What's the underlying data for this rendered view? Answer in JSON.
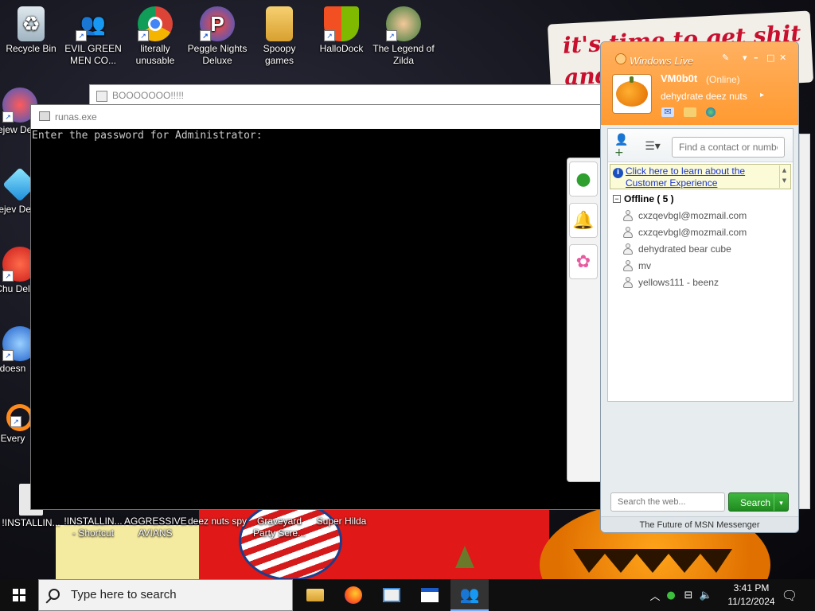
{
  "desktop": {
    "wallpaper_text": "it's time to get shit and",
    "icons": [
      {
        "label": "Recycle Bin",
        "icon": "recycle-bin-icon"
      },
      {
        "label": "EVIL GREEN MEN CO...",
        "icon": "green-men-icon"
      },
      {
        "label": "literally unusable",
        "icon": "chrome-icon"
      },
      {
        "label": "Peggle Nights Deluxe",
        "icon": "peggle-icon"
      },
      {
        "label": "Spoopy games",
        "icon": "folder-icon"
      },
      {
        "label": "HalloDock",
        "icon": "hallodock-icon"
      },
      {
        "label": "The Legend of Zilda",
        "icon": "zilda-icon"
      },
      {
        "label": "Bejew Del",
        "icon": "bejeweled-icon"
      },
      {
        "label": "Bejev Del",
        "icon": "bejeweled-gem-icon"
      },
      {
        "label": "Chu Del",
        "icon": "chuzzle-icon"
      },
      {
        "label": "doesn",
        "icon": "blue-app-icon"
      },
      {
        "label": "Every",
        "icon": "orange-app-icon"
      },
      {
        "label": "!INSTALLIN...",
        "icon": "installer-icon"
      },
      {
        "label": "!INSTALLIN... - Shortcut",
        "icon": "installer-shortcut-icon"
      },
      {
        "label": "AGGRESSIVE AVIANS",
        "icon": "avians-icon"
      },
      {
        "label": "deez nuts spy",
        "icon": "spy-icon"
      },
      {
        "label": "Graveyard Party Scre...",
        "icon": "graveyard-icon"
      },
      {
        "label": "Super Hilda",
        "icon": "hilda-icon"
      }
    ]
  },
  "bg_window": {
    "title": "BOOOOOOO!!!!!"
  },
  "console": {
    "title": "runas.exe",
    "output": "Enter the password for Administrator:"
  },
  "msn": {
    "brand": "Windows Live",
    "username": "VM0b0t",
    "status": "(Online)",
    "personal_message": "dehydrate deez nuts",
    "search_contact_placeholder": "Find a contact or number",
    "info_link": "Click here to learn about the Customer Experience",
    "group": {
      "label": "Offline ( 5 )"
    },
    "contacts": [
      {
        "name": "cxzqevbgl@mozmail.com"
      },
      {
        "name": "cxzqevbgl@mozmail.com"
      },
      {
        "name": "dehydrated bear cube"
      },
      {
        "name": "mv"
      },
      {
        "name": "yellows111 - beenz"
      }
    ],
    "web_search_placeholder": "Search the web...",
    "search_button": "Search",
    "footer": "The Future of MSN Messenger"
  },
  "taskbar": {
    "search_placeholder": "Type here to search",
    "time": "3:41 PM",
    "date": "11/12/2024"
  },
  "colors": {
    "msn_orange": "#ff9a30",
    "search_green": "#2ea02e",
    "link_blue": "#1a33cc"
  }
}
